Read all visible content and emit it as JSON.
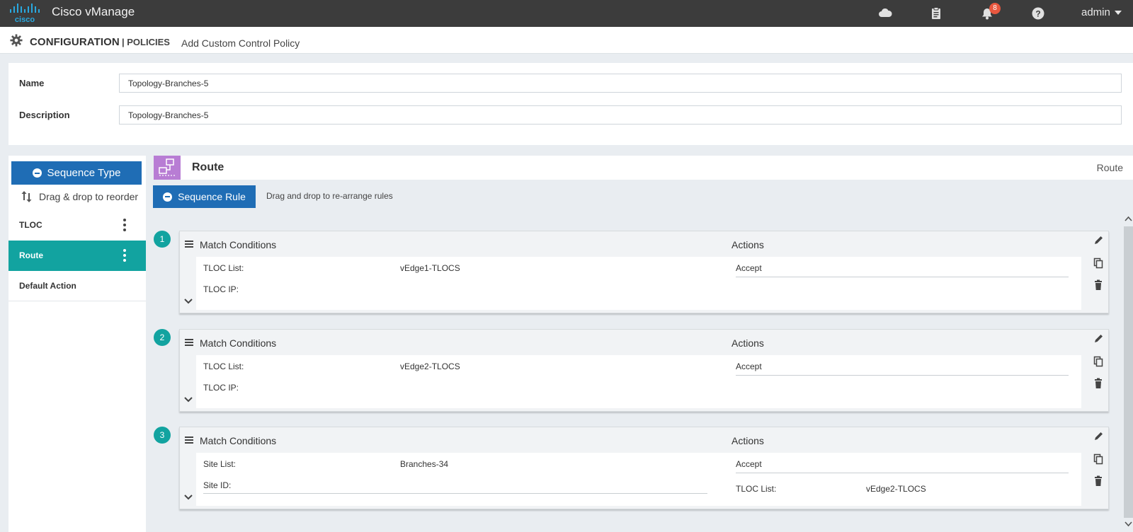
{
  "header": {
    "brand_text": "cisco",
    "app_title": "Cisco vManage",
    "notification_count": "8",
    "user": "admin"
  },
  "breadcrumb": {
    "section": "CONFIGURATION",
    "separator": "| POLICIES",
    "page": "Add Custom Control Policy"
  },
  "form": {
    "name_label": "Name",
    "name_value": "Topology-Branches-5",
    "description_label": "Description",
    "description_value": "Topology-Branches-5"
  },
  "sidebar": {
    "sequence_type_label": "Sequence Type",
    "drag_hint": "Drag & drop to reorder",
    "items": [
      {
        "label": "TLOC",
        "active": false
      },
      {
        "label": "Route",
        "active": true
      },
      {
        "label": "Default Action",
        "active": false
      }
    ]
  },
  "main": {
    "title": "Route",
    "right_label": "Route",
    "sequence_rule_label": "Sequence Rule",
    "rule_hint": "Drag and drop to re-arrange rules",
    "match_title": "Match Conditions",
    "actions_title": "Actions",
    "rules": [
      {
        "number": "1",
        "conditions": [
          {
            "label": "TLOC List:",
            "value": "vEdge1-TLOCS"
          },
          {
            "label": "TLOC IP:",
            "value": ""
          }
        ],
        "action": "Accept"
      },
      {
        "number": "2",
        "conditions": [
          {
            "label": "TLOC List:",
            "value": "vEdge2-TLOCS"
          },
          {
            "label": "TLOC IP:",
            "value": ""
          }
        ],
        "action": "Accept"
      },
      {
        "number": "3",
        "conditions": [
          {
            "label": "Site List:",
            "value": "Branches-34"
          },
          {
            "label": "Site ID:",
            "value": ""
          }
        ],
        "action": "Accept",
        "extra_action": {
          "label": "TLOC List:",
          "value": "vEdge2-TLOCS"
        }
      }
    ]
  },
  "colors": {
    "topbar": "#3c3c3c",
    "primary_button": "#1f6db5",
    "teal": "#12a3a0",
    "route_icon": "#b87dd4",
    "badge": "#e8573f"
  },
  "icons": {
    "cloud": "cloud-icon",
    "tasks": "clipboard-icon",
    "alarms": "bell-icon",
    "help": "help-icon",
    "settings": "gear-icon",
    "edit": "pencil-icon",
    "copy": "copy-icon",
    "delete": "trash-icon"
  }
}
